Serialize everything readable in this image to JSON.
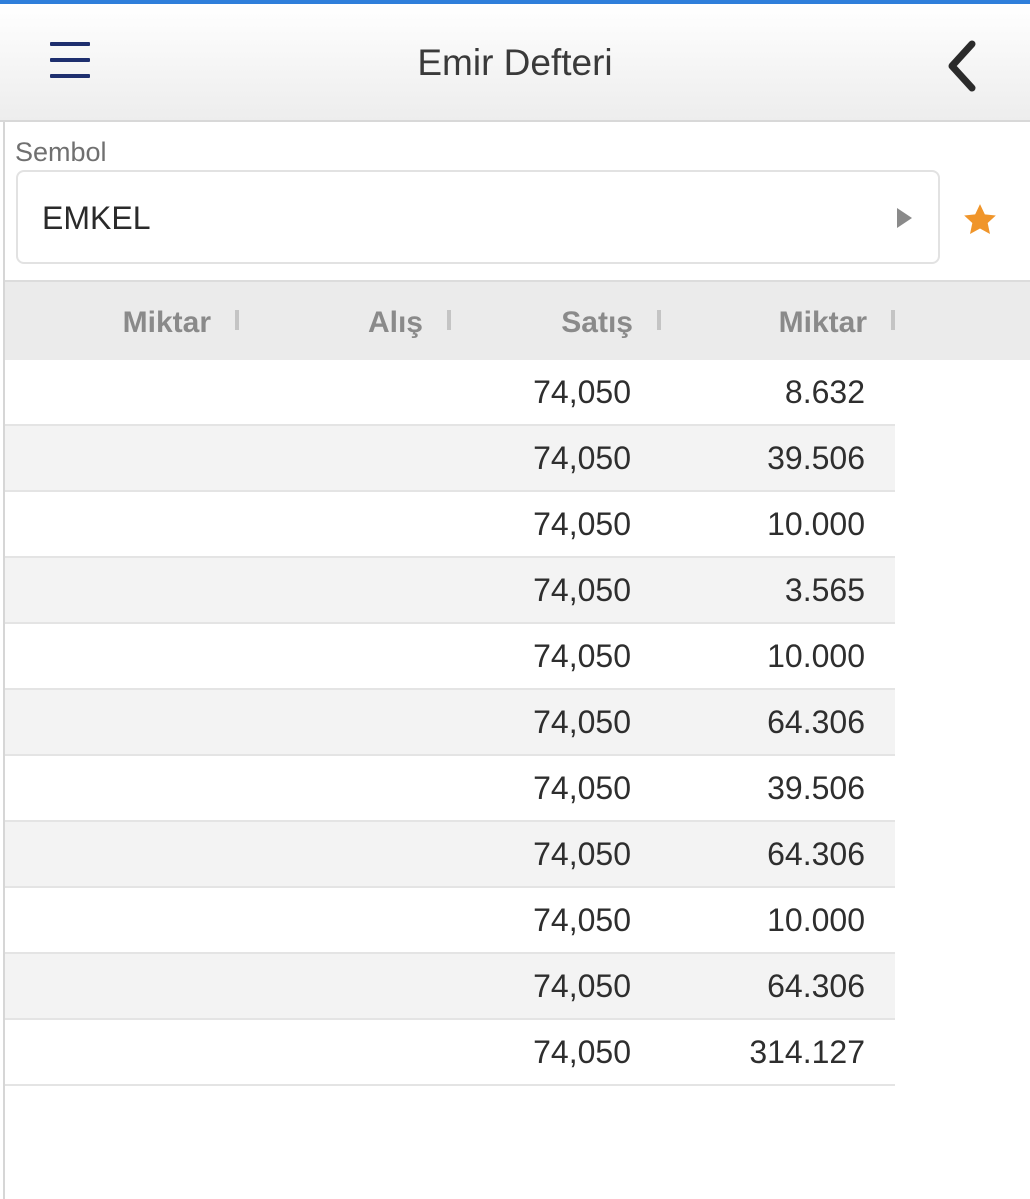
{
  "header": {
    "title": "Emir Defteri"
  },
  "symbol": {
    "label": "Sembol",
    "value": "EMKEL"
  },
  "columns": [
    "Miktar",
    "Alış",
    "Satış",
    "Miktar"
  ],
  "rows": [
    {
      "satis": "74,050",
      "miktar": "8.632"
    },
    {
      "satis": "74,050",
      "miktar": "39.506"
    },
    {
      "satis": "74,050",
      "miktar": "10.000"
    },
    {
      "satis": "74,050",
      "miktar": "3.565"
    },
    {
      "satis": "74,050",
      "miktar": "10.000"
    },
    {
      "satis": "74,050",
      "miktar": "64.306"
    },
    {
      "satis": "74,050",
      "miktar": "39.506"
    },
    {
      "satis": "74,050",
      "miktar": "64.306"
    },
    {
      "satis": "74,050",
      "miktar": "10.000"
    },
    {
      "satis": "74,050",
      "miktar": "64.306"
    },
    {
      "satis": "74,050",
      "miktar": "314.127"
    }
  ],
  "colors": {
    "accent": "#2f7fdb",
    "menu": "#1e2f6e",
    "star": "#f0952a"
  },
  "icons": [
    "hamburger-menu-icon",
    "chevron-left-icon",
    "play-arrow-icon",
    "star-icon"
  ]
}
